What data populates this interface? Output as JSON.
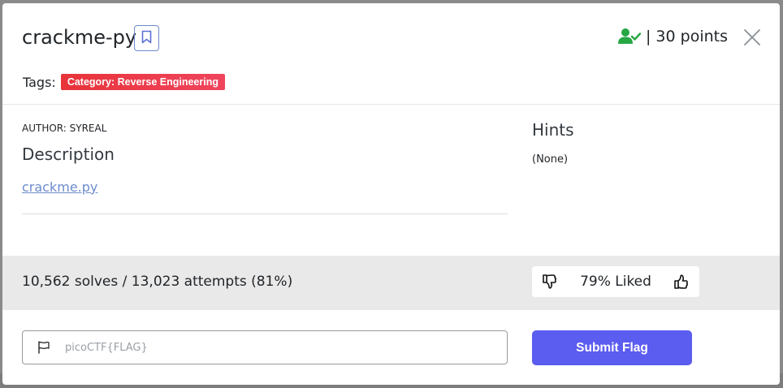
{
  "challenge": {
    "title": "crackme-py",
    "points": "| 30 points",
    "tags_label": "Tags:",
    "tags": [
      "Category: Reverse Engineering"
    ],
    "author": "AUTHOR: SYREAL",
    "description_heading": "Description",
    "description_link": "crackme.py",
    "hints_heading": "Hints",
    "hints_text": "(None)"
  },
  "stats": {
    "solves": "10,562 solves / 13,023 attempts (81%)",
    "liked": "79% Liked"
  },
  "flag_form": {
    "placeholder": "picoCTF{FLAG}",
    "submit_label": "Submit Flag"
  },
  "icons": {
    "bookmark": "bookmark-icon",
    "solved": "user-check-icon",
    "close": "close-icon",
    "thumbs_down": "thumbs-down-icon",
    "thumbs_up": "thumbs-up-icon",
    "flag": "flag-icon"
  },
  "colors": {
    "accent": "#5b5cf0",
    "badge": "#e8343a",
    "solved_green": "#28a745",
    "link": "#6c8ccd"
  }
}
